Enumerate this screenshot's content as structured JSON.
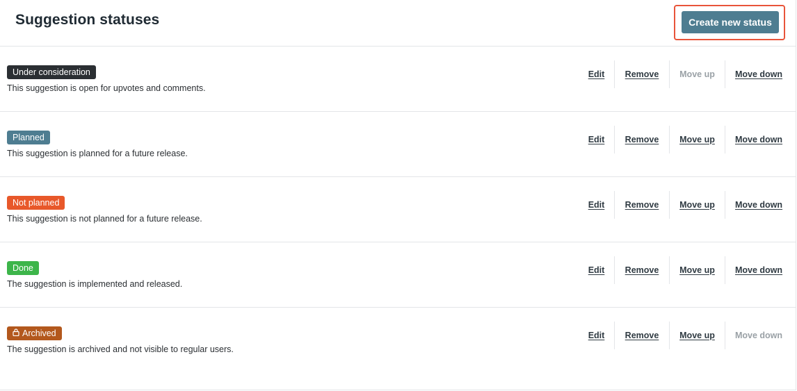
{
  "header": {
    "title": "Suggestion statuses",
    "create_button": "Create new status"
  },
  "actions_labels": {
    "edit": "Edit",
    "remove": "Remove",
    "move_up": "Move up",
    "move_down": "Move down"
  },
  "statuses": [
    {
      "label": "Under consideration",
      "color": "#2b2f33",
      "description": "This suggestion is open for upvotes and comments.",
      "move_up_enabled": false,
      "move_down_enabled": true
    },
    {
      "label": "Planned",
      "color": "#4e7d91",
      "description": "This suggestion is planned for a future release.",
      "move_up_enabled": true,
      "move_down_enabled": true
    },
    {
      "label": "Not planned",
      "color": "#e8582a",
      "description": "This suggestion is not planned for a future release.",
      "move_up_enabled": true,
      "move_down_enabled": true
    },
    {
      "label": "Done",
      "color": "#3db54a",
      "description": "The suggestion is implemented and released.",
      "move_up_enabled": true,
      "move_down_enabled": true
    },
    {
      "label": "Archived",
      "color": "#b3581d",
      "icon": "lock-icon",
      "description": "The suggestion is archived and not visible to regular users.",
      "move_up_enabled": true,
      "move_down_enabled": false
    }
  ],
  "colors": {
    "primary_button": "#4e7d91",
    "highlight_border": "#e8543a"
  }
}
